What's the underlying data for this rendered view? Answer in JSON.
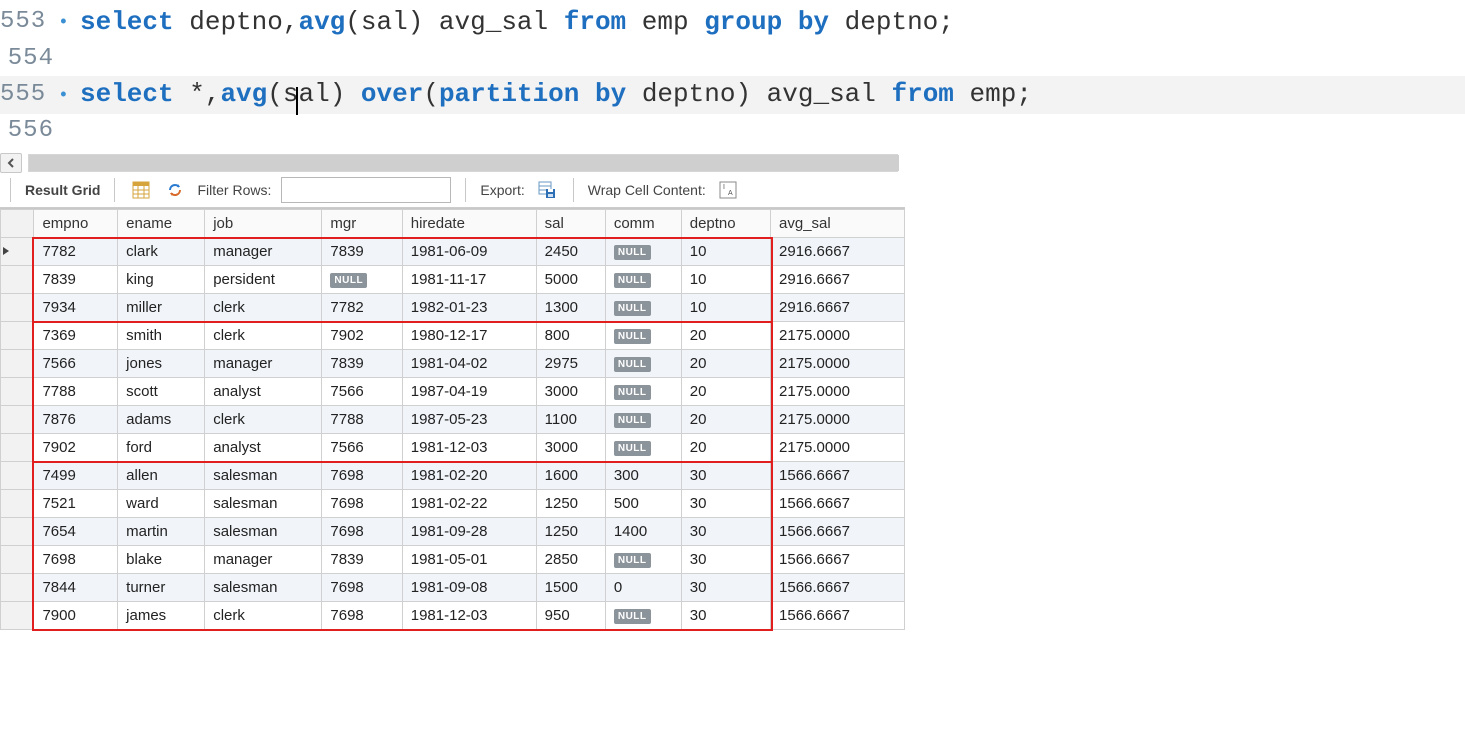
{
  "editor": {
    "lines": [
      {
        "num": "553",
        "marker": "•",
        "tokens": [
          {
            "t": "kw",
            "v": "select"
          },
          {
            "t": "sp"
          },
          {
            "t": "id",
            "v": "deptno"
          },
          {
            "t": "op",
            "v": ","
          },
          {
            "t": "fn",
            "v": "avg"
          },
          {
            "t": "op",
            "v": "("
          },
          {
            "t": "id",
            "v": "sal"
          },
          {
            "t": "op",
            "v": ")"
          },
          {
            "t": "sp"
          },
          {
            "t": "id",
            "v": "avg_sal"
          },
          {
            "t": "sp"
          },
          {
            "t": "kw",
            "v": "from"
          },
          {
            "t": "sp"
          },
          {
            "t": "id",
            "v": "emp"
          },
          {
            "t": "sp"
          },
          {
            "t": "kw",
            "v": "group"
          },
          {
            "t": "sp"
          },
          {
            "t": "kw",
            "v": "by"
          },
          {
            "t": "sp"
          },
          {
            "t": "id",
            "v": "deptno"
          },
          {
            "t": "op",
            "v": ";"
          }
        ]
      },
      {
        "num": "554",
        "marker": "",
        "tokens": []
      },
      {
        "num": "555",
        "marker": "•",
        "current": true,
        "tokens": [
          {
            "t": "kw",
            "v": "select"
          },
          {
            "t": "sp"
          },
          {
            "t": "op",
            "v": "*"
          },
          {
            "t": "op",
            "v": ","
          },
          {
            "t": "fn",
            "v": "avg"
          },
          {
            "t": "op",
            "v": "("
          },
          {
            "t": "id",
            "v": "s"
          },
          {
            "t": "caret"
          },
          {
            "t": "id",
            "v": "al"
          },
          {
            "t": "op",
            "v": ")"
          },
          {
            "t": "sp"
          },
          {
            "t": "kw",
            "v": "over"
          },
          {
            "t": "op",
            "v": "("
          },
          {
            "t": "kw",
            "v": "partition"
          },
          {
            "t": "sp"
          },
          {
            "t": "kw",
            "v": "by"
          },
          {
            "t": "sp"
          },
          {
            "t": "id",
            "v": "deptno"
          },
          {
            "t": "op",
            "v": ")"
          },
          {
            "t": "sp"
          },
          {
            "t": "id",
            "v": "avg_sal"
          },
          {
            "t": "sp"
          },
          {
            "t": "kw",
            "v": "from"
          },
          {
            "t": "sp"
          },
          {
            "t": "id",
            "v": "emp"
          },
          {
            "t": "op",
            "v": ";"
          }
        ]
      },
      {
        "num": "556",
        "marker": "",
        "tokens": []
      }
    ]
  },
  "toolbar": {
    "result_grid_label": "Result Grid",
    "filter_label": "Filter Rows:",
    "filter_value": "",
    "export_label": "Export:",
    "wrap_label": "Wrap Cell Content:"
  },
  "grid": {
    "columns": [
      "empno",
      "ename",
      "job",
      "mgr",
      "hiredate",
      "sal",
      "comm",
      "deptno",
      "avg_sal"
    ],
    "null_label": "NULL",
    "rows": [
      {
        "active": true,
        "empno": "7782",
        "ename": "clark",
        "job": "manager",
        "mgr": "7839",
        "hiredate": "1981-06-09",
        "sal": "2450",
        "comm": null,
        "deptno": "10",
        "avg_sal": "2916.6667",
        "group": 0
      },
      {
        "empno": "7839",
        "ename": "king",
        "job": "persident",
        "mgr": null,
        "hiredate": "1981-11-17",
        "sal": "5000",
        "comm": null,
        "deptno": "10",
        "avg_sal": "2916.6667",
        "group": 0
      },
      {
        "empno": "7934",
        "ename": "miller",
        "job": "clerk",
        "mgr": "7782",
        "hiredate": "1982-01-23",
        "sal": "1300",
        "comm": null,
        "deptno": "10",
        "avg_sal": "2916.6667",
        "group": 0
      },
      {
        "empno": "7369",
        "ename": "smith",
        "job": "clerk",
        "mgr": "7902",
        "hiredate": "1980-12-17",
        "sal": "800",
        "comm": null,
        "deptno": "20",
        "avg_sal": "2175.0000",
        "group": 1
      },
      {
        "empno": "7566",
        "ename": "jones",
        "job": "manager",
        "mgr": "7839",
        "hiredate": "1981-04-02",
        "sal": "2975",
        "comm": null,
        "deptno": "20",
        "avg_sal": "2175.0000",
        "group": 1
      },
      {
        "empno": "7788",
        "ename": "scott",
        "job": "analyst",
        "mgr": "7566",
        "hiredate": "1987-04-19",
        "sal": "3000",
        "comm": null,
        "deptno": "20",
        "avg_sal": "2175.0000",
        "group": 1
      },
      {
        "empno": "7876",
        "ename": "adams",
        "job": "clerk",
        "mgr": "7788",
        "hiredate": "1987-05-23",
        "sal": "1100",
        "comm": null,
        "deptno": "20",
        "avg_sal": "2175.0000",
        "group": 1
      },
      {
        "empno": "7902",
        "ename": "ford",
        "job": "analyst",
        "mgr": "7566",
        "hiredate": "1981-12-03",
        "sal": "3000",
        "comm": null,
        "deptno": "20",
        "avg_sal": "2175.0000",
        "group": 1
      },
      {
        "empno": "7499",
        "ename": "allen",
        "job": "salesman",
        "mgr": "7698",
        "hiredate": "1981-02-20",
        "sal": "1600",
        "comm": "300",
        "deptno": "30",
        "avg_sal": "1566.6667",
        "group": 2
      },
      {
        "empno": "7521",
        "ename": "ward",
        "job": "salesman",
        "mgr": "7698",
        "hiredate": "1981-02-22",
        "sal": "1250",
        "comm": "500",
        "deptno": "30",
        "avg_sal": "1566.6667",
        "group": 2
      },
      {
        "empno": "7654",
        "ename": "martin",
        "job": "salesman",
        "mgr": "7698",
        "hiredate": "1981-09-28",
        "sal": "1250",
        "comm": "1400",
        "deptno": "30",
        "avg_sal": "1566.6667",
        "group": 2
      },
      {
        "empno": "7698",
        "ename": "blake",
        "job": "manager",
        "mgr": "7839",
        "hiredate": "1981-05-01",
        "sal": "2850",
        "comm": null,
        "deptno": "30",
        "avg_sal": "1566.6667",
        "group": 2
      },
      {
        "empno": "7844",
        "ename": "turner",
        "job": "salesman",
        "mgr": "7698",
        "hiredate": "1981-09-08",
        "sal": "1500",
        "comm": "0",
        "deptno": "30",
        "avg_sal": "1566.6667",
        "group": 2
      },
      {
        "empno": "7900",
        "ename": "james",
        "job": "clerk",
        "mgr": "7698",
        "hiredate": "1981-12-03",
        "sal": "950",
        "comm": null,
        "deptno": "30",
        "avg_sal": "1566.6667",
        "group": 2
      }
    ]
  }
}
